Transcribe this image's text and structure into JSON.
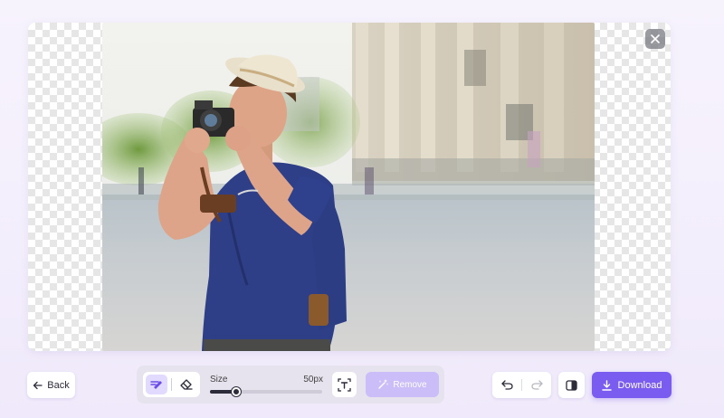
{
  "canvas": {
    "photo_alt": "Young man in a straw hat taking a photo with a vintage camera",
    "close_icon": "close-icon"
  },
  "toolbar_left": {
    "back_label": "Back",
    "back_icon": "arrow-left-icon"
  },
  "brush_toolbar": {
    "restore_tool_icon": "restore-brush-icon",
    "erase_tool_icon": "eraser-icon",
    "size_label": "Size",
    "size_value": "50px",
    "size_fraction": 0.23,
    "text_tool_icon": "text-select-icon",
    "remove_label": "Remove",
    "remove_icon": "magic-wand-icon"
  },
  "toolbar_right": {
    "undo_icon": "undo-icon",
    "redo_icon": "redo-icon",
    "compare_icon": "compare-icon",
    "download_label": "Download",
    "download_icon": "download-icon"
  },
  "colors": {
    "accent": "#7b5cf0",
    "accent_disabled": "#cbbdf7",
    "active_tool_bg": "#e2dbff"
  }
}
